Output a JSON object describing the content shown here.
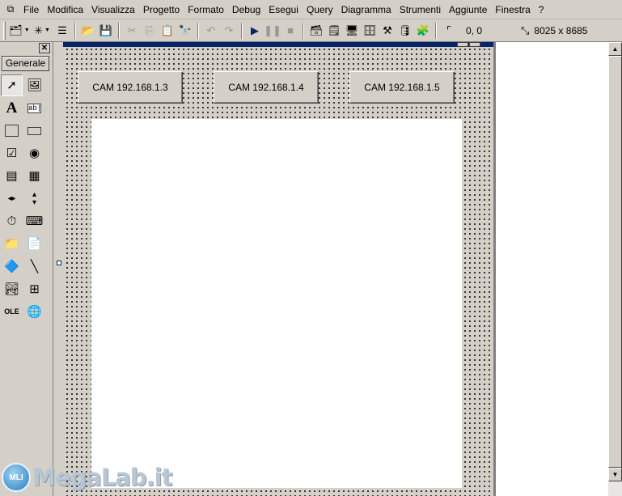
{
  "menubar": {
    "app_icon": "vb-app-icon",
    "items": [
      "File",
      "Modifica",
      "Visualizza",
      "Progetto",
      "Formato",
      "Debug",
      "Esegui",
      "Query",
      "Diagramma",
      "Strumenti",
      "Aggiunte",
      "Finestra",
      "?"
    ]
  },
  "toolbar": {
    "coords": "0, 0",
    "size": "8025 x 8685"
  },
  "toolbox": {
    "close_label": "✕",
    "tab_label": "Generale"
  },
  "form": {
    "buttons": [
      "CAM  192.168.1.3",
      "CAM  192.168.1.4",
      "CAM  192.168.1.5"
    ]
  },
  "watermark": {
    "logo_text": "MLI",
    "text": "MegaLab.it"
  },
  "colors": {
    "face": "#d4d0c8",
    "title_active": "#0a246a",
    "workspace": "#808080"
  }
}
